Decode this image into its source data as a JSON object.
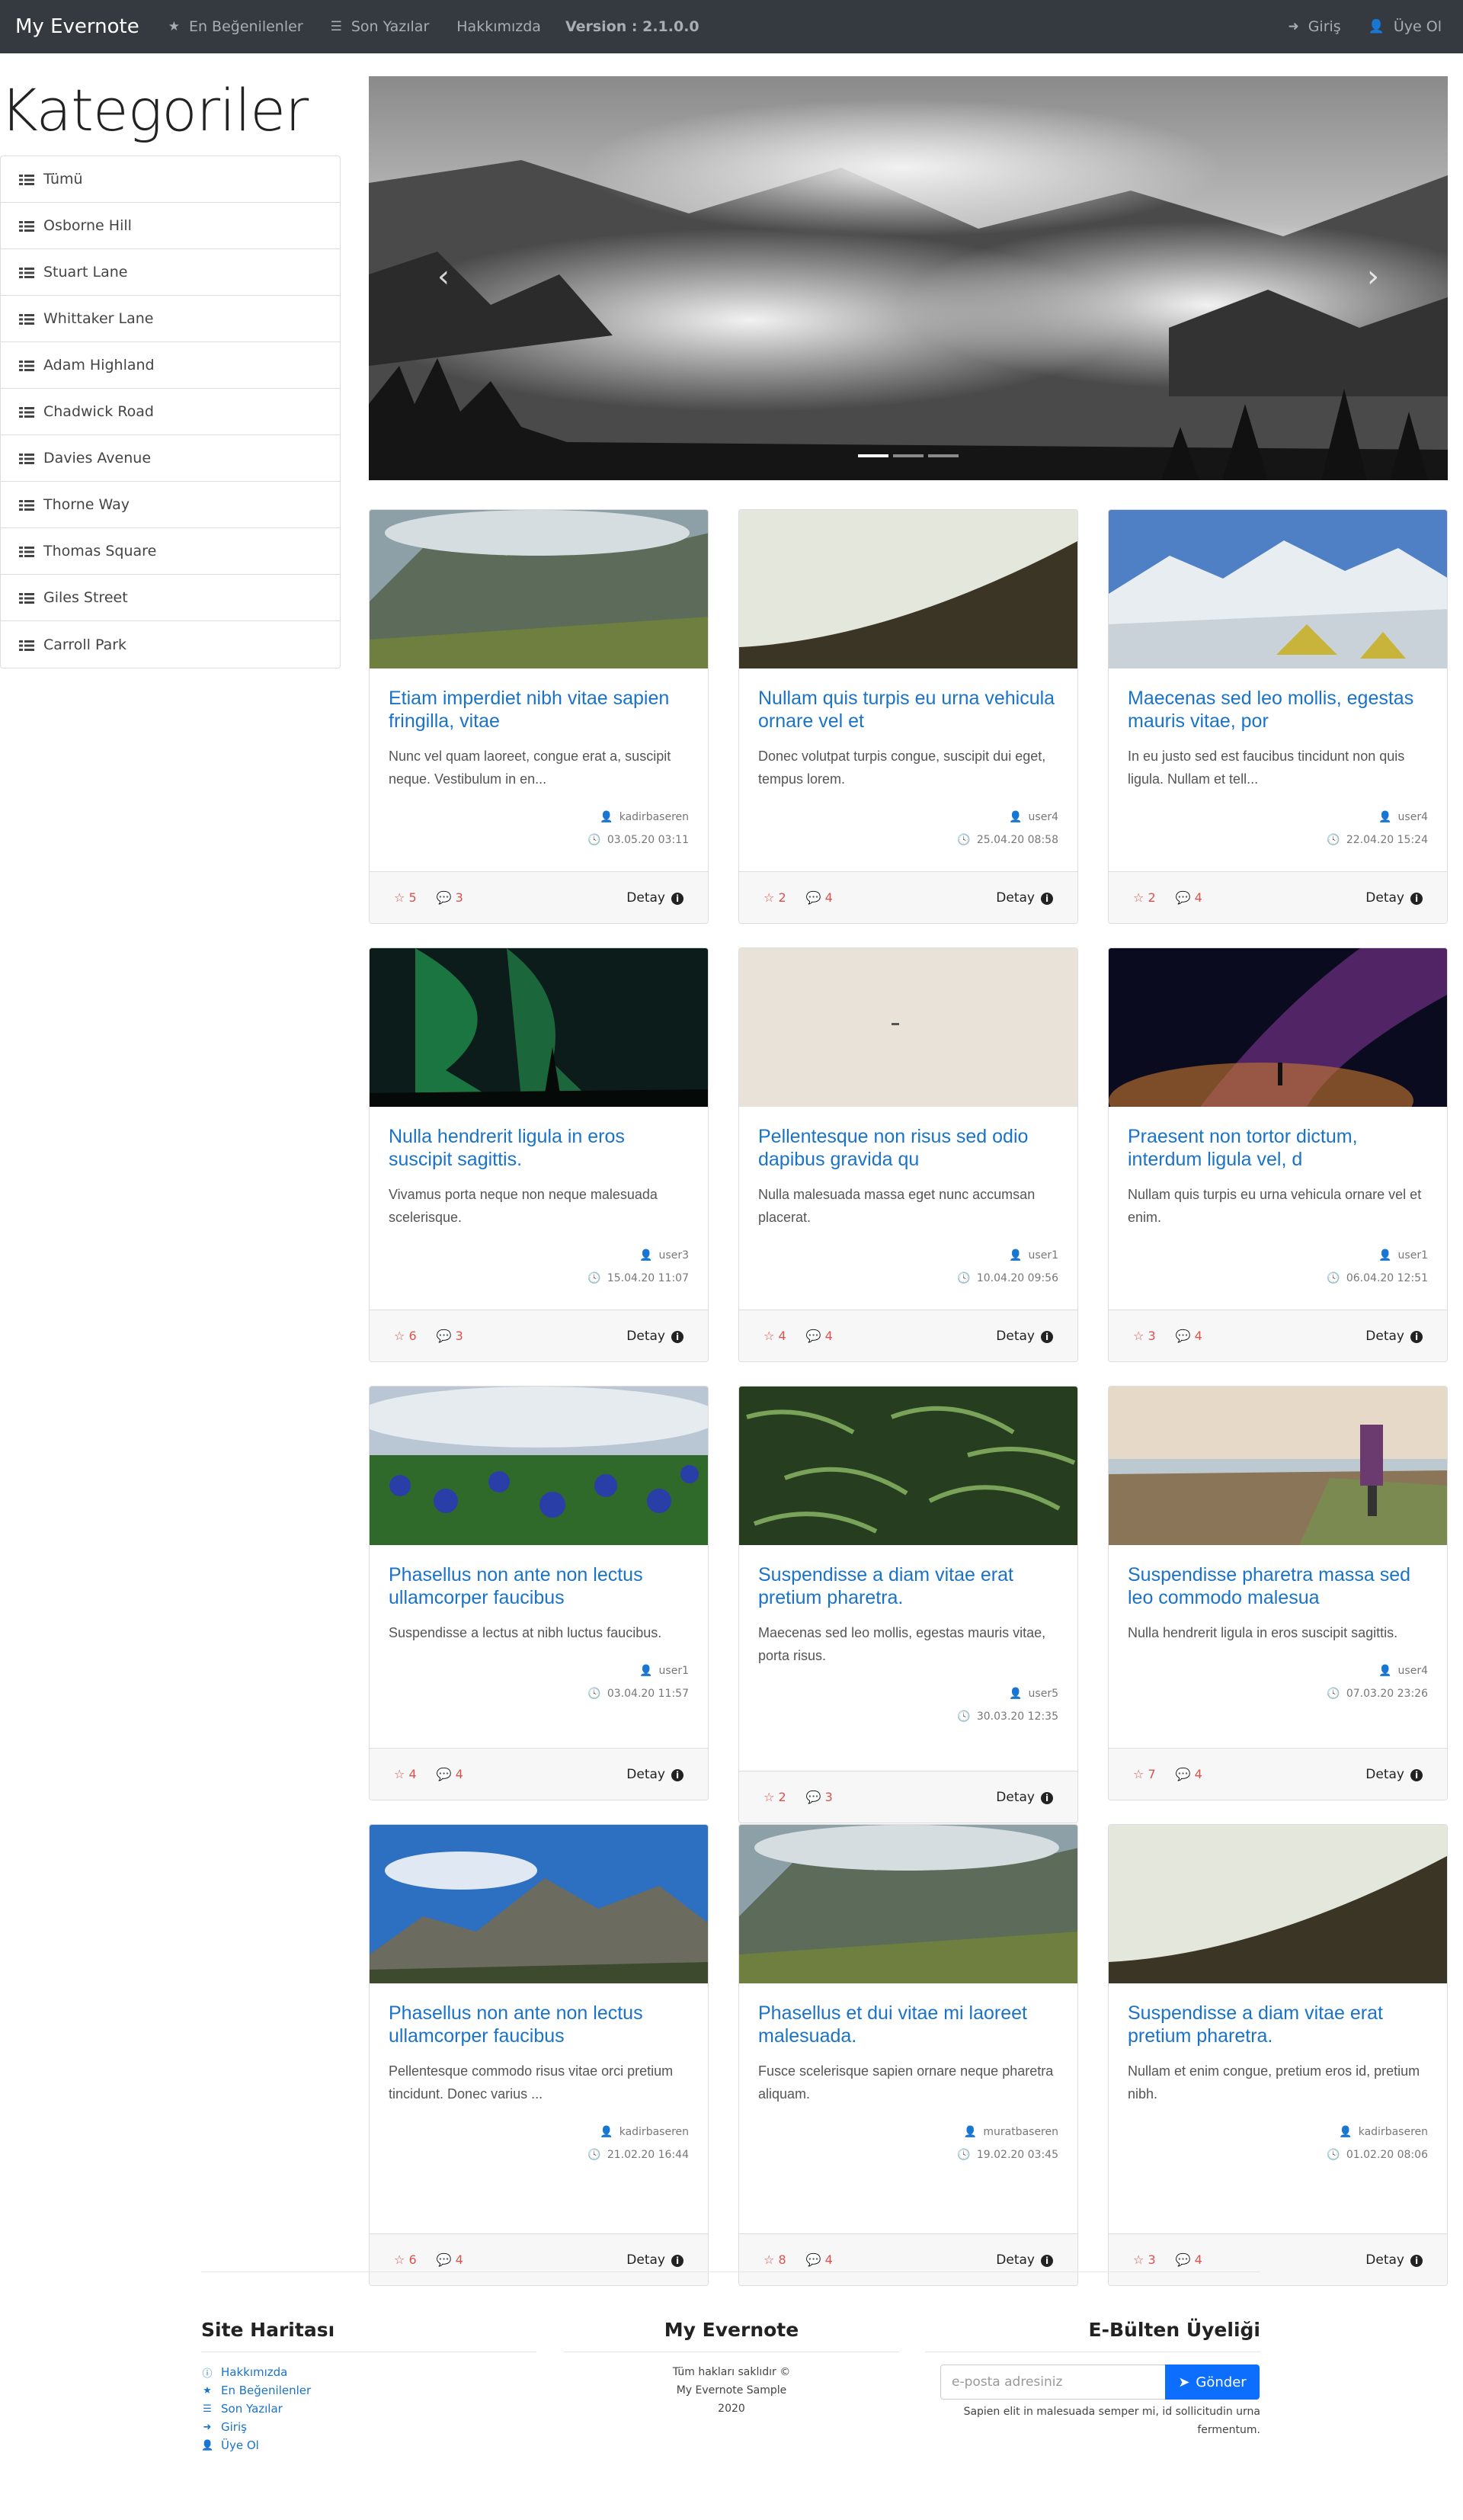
{
  "navbar": {
    "brand": "My Evernote",
    "items": [
      {
        "label": "En Beğenilenler",
        "icon": "star-icon"
      },
      {
        "label": "Son Yazılar",
        "icon": "list-icon"
      },
      {
        "label": "Hakkımızda",
        "icon": ""
      }
    ],
    "version": "Version : 2.1.0.0",
    "right": [
      {
        "label": "Giriş",
        "icon": "sign-in-icon"
      },
      {
        "label": "Üye Ol",
        "icon": "user-icon"
      }
    ]
  },
  "sidebar": {
    "title": "Kategoriler",
    "items": [
      "Tümü",
      "Osborne Hill",
      "Stuart Lane",
      "Whittaker Lane",
      "Adam Highland",
      "Chadwick Road",
      "Davies Avenue",
      "Thorne Way",
      "Thomas Square",
      "Giles Street",
      "Carroll Park"
    ]
  },
  "carousel": {
    "prev": "‹",
    "next": "›",
    "slides": 3,
    "active": 0
  },
  "cards": [
    {
      "title": "Etiam imperdiet nibh vitae sapien fringilla, vitae",
      "text": "Nunc vel quam laoreet, congue erat a, suscipit neque. Vestibulum in en...",
      "user": "kadirbaseren",
      "date": "03.05.20 03:11",
      "likes": "5",
      "comments": "3",
      "detail": "Detay"
    },
    {
      "title": "Nullam quis turpis eu urna vehicula ornare vel et",
      "text": "Donec volutpat turpis congue, suscipit dui eget, tempus lorem.",
      "user": "user4",
      "date": "25.04.20 08:58",
      "likes": "2",
      "comments": "4",
      "detail": "Detay"
    },
    {
      "title": "Maecenas sed leo mollis, egestas mauris vitae, por",
      "text": "In eu justo sed est faucibus tincidunt non quis ligula. Nullam et tell...",
      "user": "user4",
      "date": "22.04.20 15:24",
      "likes": "2",
      "comments": "4",
      "detail": "Detay"
    },
    {
      "title": "Nulla hendrerit ligula in eros suscipit sagittis.",
      "text": "Vivamus porta neque non neque malesuada scelerisque.",
      "user": "user3",
      "date": "15.04.20 11:07",
      "likes": "6",
      "comments": "3",
      "detail": "Detay"
    },
    {
      "title": "Pellentesque non risus sed odio dapibus gravida qu",
      "text": "Nulla malesuada massa eget nunc accumsan placerat.",
      "user": "user1",
      "date": "10.04.20 09:56",
      "likes": "4",
      "comments": "4",
      "detail": "Detay"
    },
    {
      "title": "Praesent non tortor dictum, interdum ligula vel, d",
      "text": "Nullam quis turpis eu urna vehicula ornare vel et enim.",
      "user": "user1",
      "date": "06.04.20 12:51",
      "likes": "3",
      "comments": "4",
      "detail": "Detay"
    },
    {
      "title": "Phasellus non ante non lectus ullamcorper faucibus",
      "text": "Suspendisse a lectus at nibh luctus faucibus.",
      "user": "user1",
      "date": "03.04.20 11:57",
      "likes": "4",
      "comments": "4",
      "detail": "Detay"
    },
    {
      "title": "Suspendisse a diam vitae erat pretium pharetra.",
      "text": "Maecenas sed leo mollis, egestas mauris vitae, porta risus.",
      "user": "user5",
      "date": "30.03.20 12:35",
      "likes": "2",
      "comments": "3",
      "detail": "Detay"
    },
    {
      "title": "Suspendisse pharetra massa sed leo commodo malesua",
      "text": "Nulla hendrerit ligula in eros suscipit sagittis.",
      "user": "user4",
      "date": "07.03.20 23:26",
      "likes": "7",
      "comments": "4",
      "detail": "Detay"
    },
    {
      "title": "Phasellus non ante non lectus ullamcorper faucibus",
      "text": "Pellentesque commodo risus vitae orci pretium tincidunt. Donec varius ...",
      "user": "kadirbaseren",
      "date": "21.02.20 16:44",
      "likes": "6",
      "comments": "4",
      "detail": "Detay"
    },
    {
      "title": "Phasellus et dui vitae mi laoreet malesuada.",
      "text": "Fusce scelerisque sapien ornare neque pharetra aliquam.",
      "user": "muratbaseren",
      "date": "19.02.20 03:45",
      "likes": "8",
      "comments": "4",
      "detail": "Detay"
    },
    {
      "title": "Suspendisse a diam vitae erat pretium pharetra.",
      "text": "Nullam et enim congue, pretium eros id, pretium nibh.",
      "user": "kadirbaseren",
      "date": "01.02.20 08:06",
      "likes": "3",
      "comments": "4",
      "detail": "Detay"
    }
  ],
  "footer": {
    "sitemap_title": "Site Haritası",
    "sitemap": [
      {
        "label": "Hakkımızda",
        "icon": "info-icon"
      },
      {
        "label": "En Beğenilenler",
        "icon": "star-icon"
      },
      {
        "label": "Son Yazılar",
        "icon": "list-icon"
      },
      {
        "label": "Giriş",
        "icon": "sign-in-icon"
      },
      {
        "label": "Üye Ol",
        "icon": "user-icon"
      }
    ],
    "center_title": "My Evernote",
    "copyright_1": "Tüm hakları saklıdır ©",
    "copyright_2": "My Evernote Sample",
    "copyright_3": "2020",
    "newsletter_title": "E-Bülten Üyeliği",
    "newsletter_placeholder": "e-posta adresiniz",
    "newsletter_button": "Gönder",
    "newsletter_note": "Sapien elit in malesuada semper mi, id sollicitudin urna fermentum."
  },
  "colors": {
    "navbar": "#343a40",
    "link": "#1a73c8",
    "like": "#d9534f",
    "button": "#0d6efd"
  }
}
